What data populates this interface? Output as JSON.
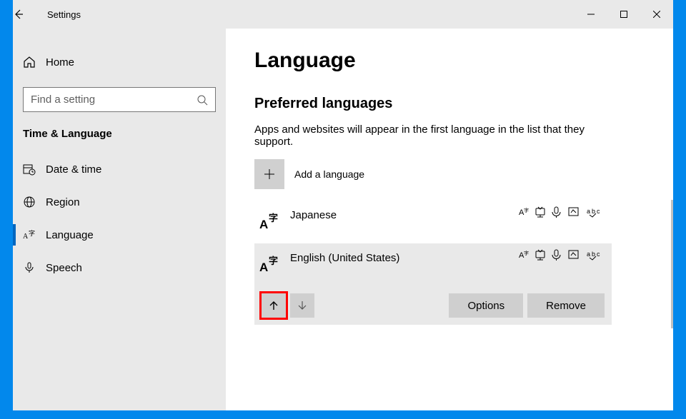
{
  "window": {
    "app_title": "Settings"
  },
  "sidebar": {
    "home_label": "Home",
    "search_placeholder": "Find a setting",
    "category": "Time & Language",
    "items": [
      {
        "label": "Date & time"
      },
      {
        "label": "Region"
      },
      {
        "label": "Language"
      },
      {
        "label": "Speech"
      }
    ]
  },
  "content": {
    "title": "Language",
    "section": "Preferred languages",
    "description": "Apps and websites will appear in the first language in the list that they support.",
    "add_label": "Add a language",
    "languages": [
      {
        "name": "Japanese"
      },
      {
        "name": "English (United States)"
      }
    ],
    "actions": {
      "options": "Options",
      "remove": "Remove"
    }
  }
}
